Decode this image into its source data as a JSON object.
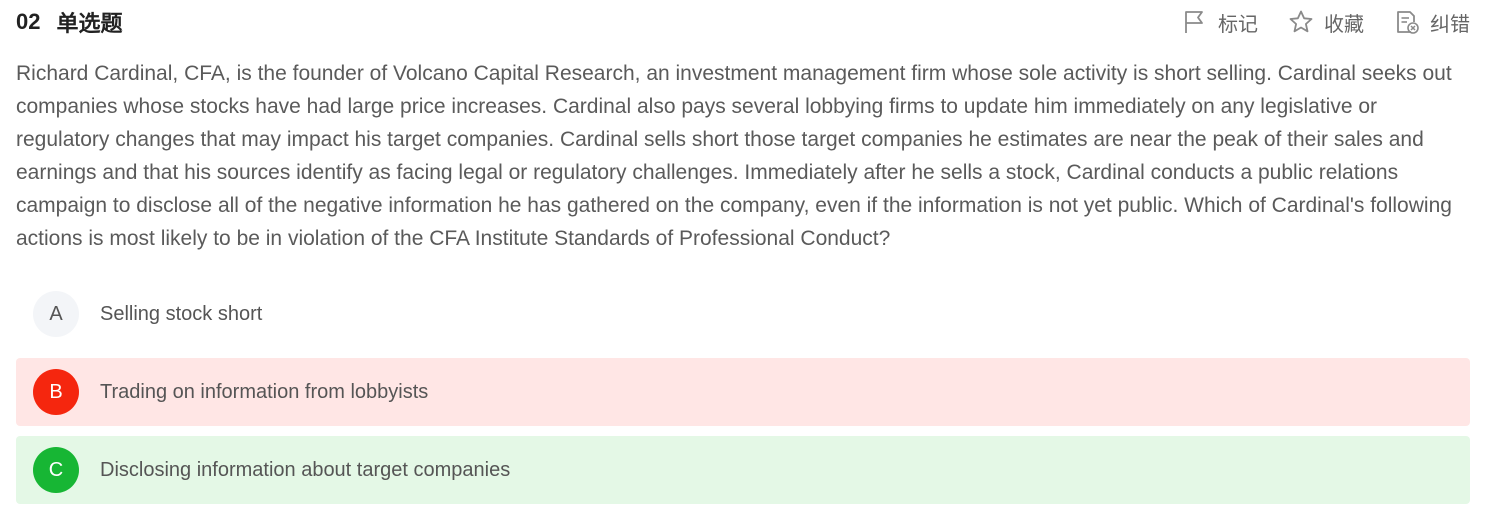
{
  "question": {
    "number": "02",
    "type": "单选题",
    "stem": "Richard Cardinal, CFA, is the founder of Volcano Capital Research, an investment management firm whose sole activity is short selling. Cardinal seeks out companies whose stocks have had large price increases. Cardinal also pays several lobbying firms to update him immediately on any legislative or regulatory changes that may impact his target companies. Cardinal sells short those target companies he estimates are near the peak of their sales and earnings and that his sources identify as facing legal or regulatory challenges. Immediately after he sells a stock, Cardinal conducts a public relations campaign to disclose all of the negative information he has gathered on the company, even if the information is not yet public. Which of Cardinal's following actions is most likely to be in violation of the CFA Institute Standards of Professional Conduct?"
  },
  "toolbar": {
    "mark_label": "标记",
    "mark_icon": "flag-icon",
    "favorite_label": "收藏",
    "favorite_icon": "star-icon",
    "report_label": "纠错",
    "report_icon": "document-error-icon"
  },
  "options": [
    {
      "letter": "A",
      "text": "Selling stock short",
      "state": "plain"
    },
    {
      "letter": "B",
      "text": "Trading on information from lobbyists",
      "state": "wrong"
    },
    {
      "letter": "C",
      "text": "Disclosing information about target companies",
      "state": "right"
    }
  ],
  "colors": {
    "wrong_bg": "#ffe6e5",
    "wrong_accent": "#f5260e",
    "right_bg": "#e4f8e6",
    "right_accent": "#17b634",
    "neutral_circle": "#f3f5f8"
  }
}
